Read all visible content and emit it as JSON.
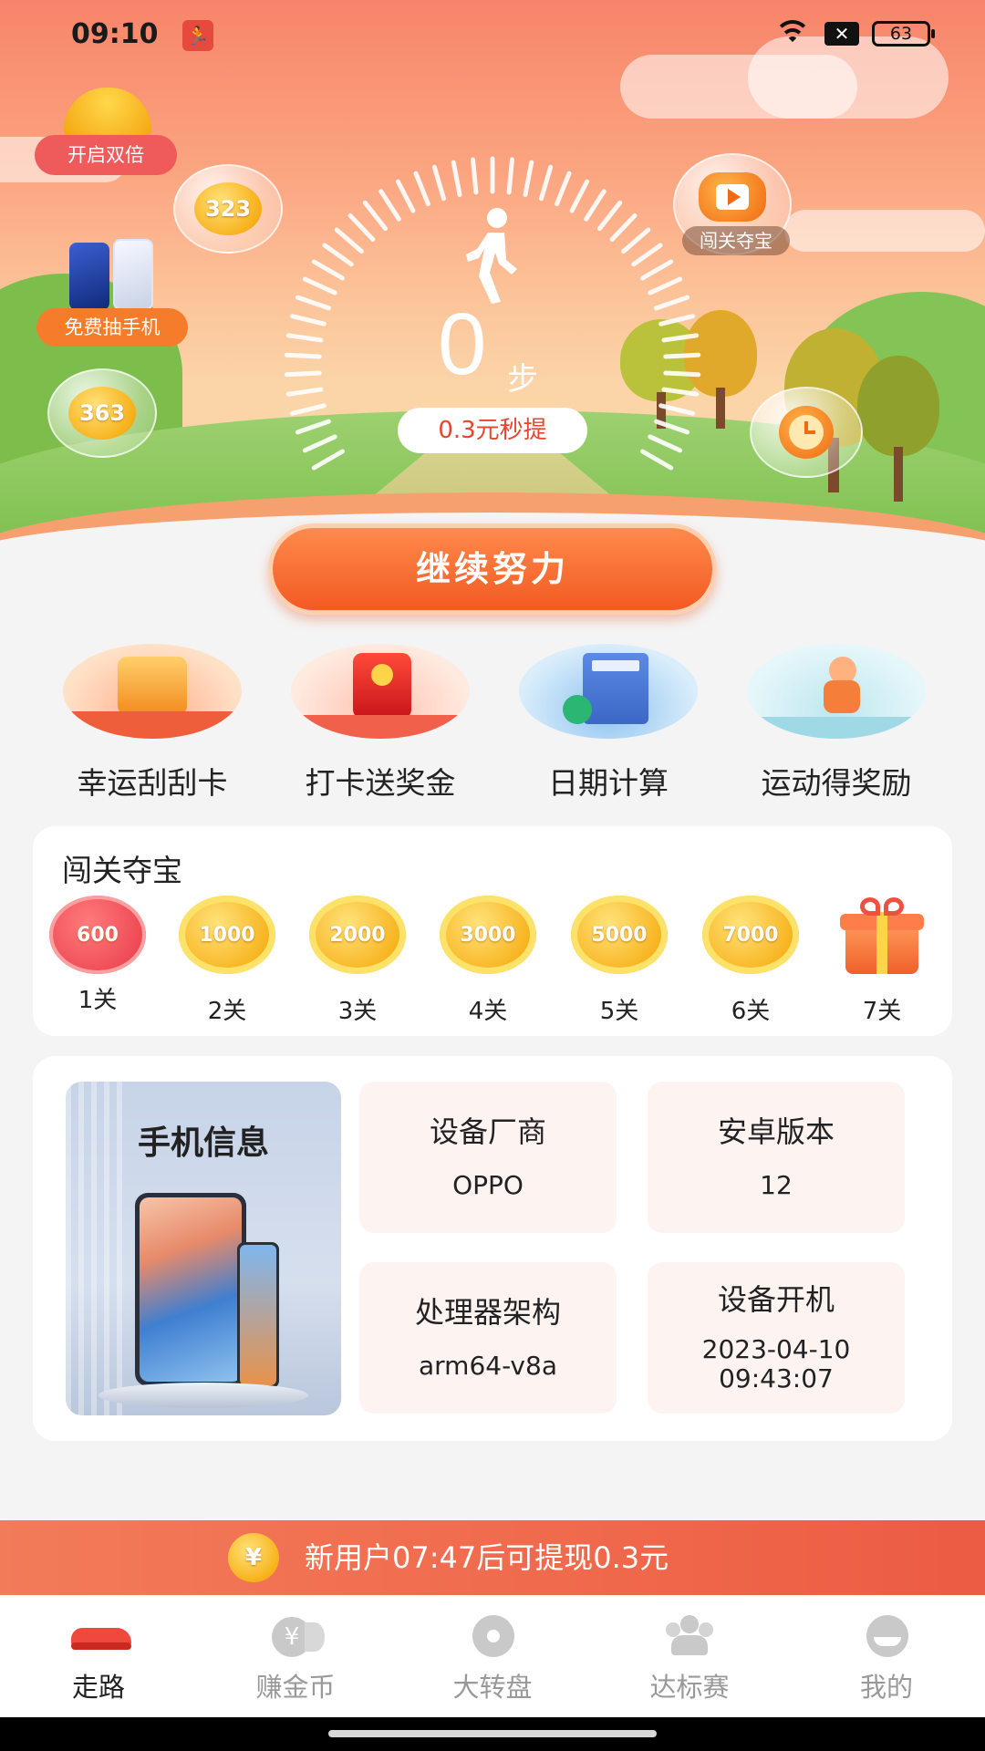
{
  "status_bar": {
    "time": "09:10",
    "battery": "63",
    "signal_box": "✕"
  },
  "hero": {
    "double_label": "开启双倍",
    "bubble_coin_1": "323",
    "bubble_coin_2": "363",
    "free_phone_label": "免费抽手机",
    "treasure_label": "闯关夺宝",
    "steps": "0",
    "steps_unit": "步",
    "withdraw_label": "0.3元秒提",
    "main_button": "继续努力"
  },
  "features": [
    {
      "label": "幸运刮刮卡",
      "icon": "scratch-card-icon"
    },
    {
      "label": "打卡送奖金",
      "icon": "checkin-bonus-icon"
    },
    {
      "label": "日期计算",
      "icon": "calendar-calculator-icon"
    },
    {
      "label": "运动得奖励",
      "icon": "running-reward-icon"
    }
  ],
  "levels": {
    "title": "闯关夺宝",
    "items": [
      {
        "value": "600",
        "label": "1关"
      },
      {
        "value": "1000",
        "label": "2关"
      },
      {
        "value": "2000",
        "label": "3关"
      },
      {
        "value": "3000",
        "label": "4关"
      },
      {
        "value": "5000",
        "label": "5关"
      },
      {
        "value": "7000",
        "label": "6关"
      },
      {
        "value": "",
        "label": "7关"
      }
    ]
  },
  "phone_info": {
    "title": "手机信息",
    "manufacturer_label": "设备厂商",
    "manufacturer_value": "OPPO",
    "android_label": "安卓版本",
    "android_value": "12",
    "arch_label": "处理器架构",
    "arch_value": "arm64-v8a",
    "boot_label": "设备开机",
    "boot_date": "2023-04-10",
    "boot_time": "09:43:07"
  },
  "banner": {
    "coin": "¥",
    "text": "新用户07:47后可提现0.3元"
  },
  "nav": {
    "items": [
      {
        "label": "走路",
        "icon": "shoe-icon",
        "active": true
      },
      {
        "label": "赚金币",
        "icon": "coin-icon",
        "active": false
      },
      {
        "label": "大转盘",
        "icon": "wheel-icon",
        "active": false
      },
      {
        "label": "达标赛",
        "icon": "group-icon",
        "active": false
      },
      {
        "label": "我的",
        "icon": "profile-icon",
        "active": false
      }
    ]
  },
  "colors": {
    "accent": "#f25a22",
    "banner": "#f0694c",
    "level_active": "#f0505a",
    "coin": "#f7b21c"
  }
}
